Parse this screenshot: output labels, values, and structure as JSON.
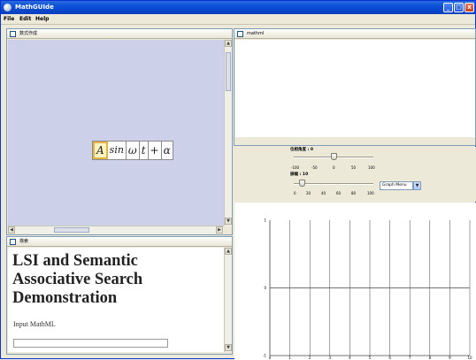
{
  "window": {
    "title": "MathGUIde",
    "icon": "app-globe-icon",
    "controls": {
      "minimize": "_",
      "maximize": "□",
      "close": "x"
    }
  },
  "menu": [
    "File",
    "Edit",
    "Help"
  ],
  "panels": {
    "formula_editor": {
      "title": "数式作成",
      "formula_parts": [
        "A",
        "sin",
        "ω",
        "t",
        "+",
        "α"
      ],
      "selected_part": "A"
    },
    "document": {
      "title": "検索",
      "heading": "LSI and Semantic Associative Search Demonstration",
      "input_label": "Input MathML",
      "input_value": ""
    },
    "mathml": {
      "title": "mathml"
    }
  },
  "controls": {
    "slider1": {
      "label": "位相角度 : 0",
      "ticks": [
        "-100",
        "-50",
        "0",
        "50",
        "100"
      ],
      "value": 0
    },
    "slider2": {
      "label": "振幅 : 10",
      "ticks": [
        "0",
        "20",
        "40",
        "60",
        "80",
        "100"
      ],
      "value": 10
    },
    "graph_menu": {
      "selected": "Graph Menu"
    }
  },
  "graph": {
    "x_ticks": [
      "0",
      "1",
      "2",
      "3",
      "4",
      "5",
      "6",
      "7",
      "8",
      "9",
      "10"
    ],
    "y_ticks": [
      "1",
      "0",
      "-1"
    ],
    "colors": {
      "grid": "#444444",
      "background": "#ffffff"
    }
  }
}
